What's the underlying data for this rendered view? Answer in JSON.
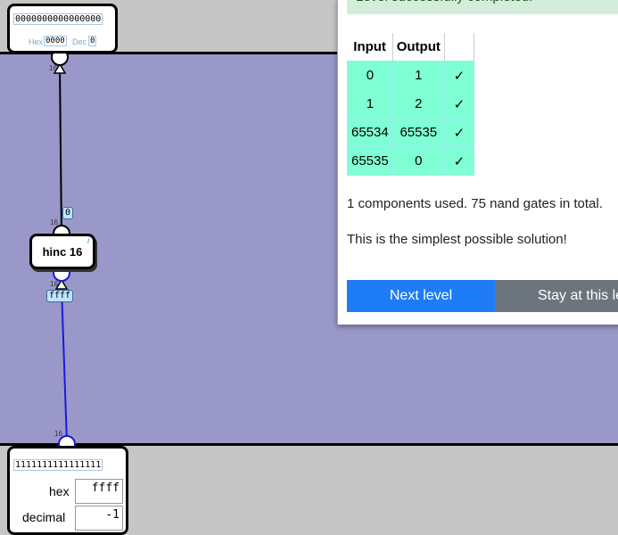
{
  "output_pin": {
    "bits": "0000000000000000",
    "hex_label": "Hex",
    "hex_value": "0000",
    "dec_label": "Dec",
    "dec_value": "0"
  },
  "component": {
    "name": "hinc 16",
    "info": "i",
    "out_value": "0",
    "in_value": "ffff"
  },
  "bus_width": "16",
  "input_pin": {
    "bits": "1111111111111111",
    "hex_label": "hex",
    "hex_value": "ffff",
    "dec_label": "decimal",
    "dec_value": "-1"
  },
  "panel": {
    "alert": "Level successfully completed.",
    "table": {
      "headers": [
        "Input",
        "Output"
      ],
      "rows": [
        [
          "0",
          "1",
          "✓"
        ],
        [
          "1",
          "2",
          "✓"
        ],
        [
          "65534",
          "65535",
          "✓"
        ],
        [
          "65535",
          "0",
          "✓"
        ]
      ]
    },
    "summary": "1 components used. 75 nand gates in total.",
    "note": "This is the simplest possible solution!",
    "next_button": "Next level",
    "stay_button": "Stay at this level"
  }
}
